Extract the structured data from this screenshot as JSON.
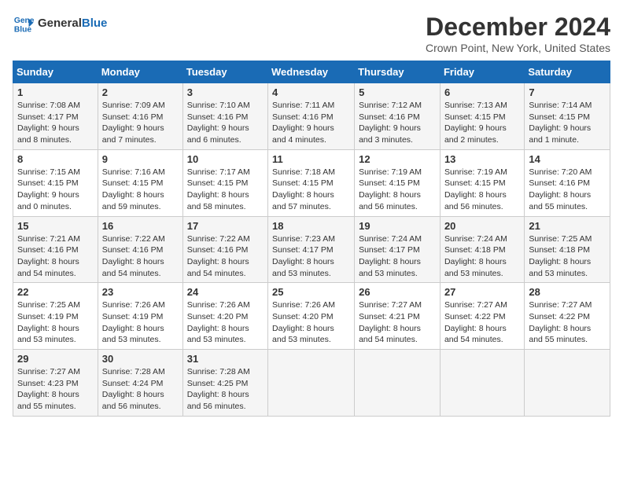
{
  "logo": {
    "text_general": "General",
    "text_blue": "Blue"
  },
  "title": "December 2024",
  "location": "Crown Point, New York, United States",
  "days_header": [
    "Sunday",
    "Monday",
    "Tuesday",
    "Wednesday",
    "Thursday",
    "Friday",
    "Saturday"
  ],
  "weeks": [
    [
      {
        "day": "1",
        "sunrise": "7:08 AM",
        "sunset": "4:17 PM",
        "daylight": "9 hours and 8 minutes."
      },
      {
        "day": "2",
        "sunrise": "7:09 AM",
        "sunset": "4:16 PM",
        "daylight": "9 hours and 7 minutes."
      },
      {
        "day": "3",
        "sunrise": "7:10 AM",
        "sunset": "4:16 PM",
        "daylight": "9 hours and 6 minutes."
      },
      {
        "day": "4",
        "sunrise": "7:11 AM",
        "sunset": "4:16 PM",
        "daylight": "9 hours and 4 minutes."
      },
      {
        "day": "5",
        "sunrise": "7:12 AM",
        "sunset": "4:16 PM",
        "daylight": "9 hours and 3 minutes."
      },
      {
        "day": "6",
        "sunrise": "7:13 AM",
        "sunset": "4:15 PM",
        "daylight": "9 hours and 2 minutes."
      },
      {
        "day": "7",
        "sunrise": "7:14 AM",
        "sunset": "4:15 PM",
        "daylight": "9 hours and 1 minute."
      }
    ],
    [
      {
        "day": "8",
        "sunrise": "7:15 AM",
        "sunset": "4:15 PM",
        "daylight": "9 hours and 0 minutes."
      },
      {
        "day": "9",
        "sunrise": "7:16 AM",
        "sunset": "4:15 PM",
        "daylight": "8 hours and 59 minutes."
      },
      {
        "day": "10",
        "sunrise": "7:17 AM",
        "sunset": "4:15 PM",
        "daylight": "8 hours and 58 minutes."
      },
      {
        "day": "11",
        "sunrise": "7:18 AM",
        "sunset": "4:15 PM",
        "daylight": "8 hours and 57 minutes."
      },
      {
        "day": "12",
        "sunrise": "7:19 AM",
        "sunset": "4:15 PM",
        "daylight": "8 hours and 56 minutes."
      },
      {
        "day": "13",
        "sunrise": "7:19 AM",
        "sunset": "4:15 PM",
        "daylight": "8 hours and 56 minutes."
      },
      {
        "day": "14",
        "sunrise": "7:20 AM",
        "sunset": "4:16 PM",
        "daylight": "8 hours and 55 minutes."
      }
    ],
    [
      {
        "day": "15",
        "sunrise": "7:21 AM",
        "sunset": "4:16 PM",
        "daylight": "8 hours and 54 minutes."
      },
      {
        "day": "16",
        "sunrise": "7:22 AM",
        "sunset": "4:16 PM",
        "daylight": "8 hours and 54 minutes."
      },
      {
        "day": "17",
        "sunrise": "7:22 AM",
        "sunset": "4:16 PM",
        "daylight": "8 hours and 54 minutes."
      },
      {
        "day": "18",
        "sunrise": "7:23 AM",
        "sunset": "4:17 PM",
        "daylight": "8 hours and 53 minutes."
      },
      {
        "day": "19",
        "sunrise": "7:24 AM",
        "sunset": "4:17 PM",
        "daylight": "8 hours and 53 minutes."
      },
      {
        "day": "20",
        "sunrise": "7:24 AM",
        "sunset": "4:18 PM",
        "daylight": "8 hours and 53 minutes."
      },
      {
        "day": "21",
        "sunrise": "7:25 AM",
        "sunset": "4:18 PM",
        "daylight": "8 hours and 53 minutes."
      }
    ],
    [
      {
        "day": "22",
        "sunrise": "7:25 AM",
        "sunset": "4:19 PM",
        "daylight": "8 hours and 53 minutes."
      },
      {
        "day": "23",
        "sunrise": "7:26 AM",
        "sunset": "4:19 PM",
        "daylight": "8 hours and 53 minutes."
      },
      {
        "day": "24",
        "sunrise": "7:26 AM",
        "sunset": "4:20 PM",
        "daylight": "8 hours and 53 minutes."
      },
      {
        "day": "25",
        "sunrise": "7:26 AM",
        "sunset": "4:20 PM",
        "daylight": "8 hours and 53 minutes."
      },
      {
        "day": "26",
        "sunrise": "7:27 AM",
        "sunset": "4:21 PM",
        "daylight": "8 hours and 54 minutes."
      },
      {
        "day": "27",
        "sunrise": "7:27 AM",
        "sunset": "4:22 PM",
        "daylight": "8 hours and 54 minutes."
      },
      {
        "day": "28",
        "sunrise": "7:27 AM",
        "sunset": "4:22 PM",
        "daylight": "8 hours and 55 minutes."
      }
    ],
    [
      {
        "day": "29",
        "sunrise": "7:27 AM",
        "sunset": "4:23 PM",
        "daylight": "8 hours and 55 minutes."
      },
      {
        "day": "30",
        "sunrise": "7:28 AM",
        "sunset": "4:24 PM",
        "daylight": "8 hours and 56 minutes."
      },
      {
        "day": "31",
        "sunrise": "7:28 AM",
        "sunset": "4:25 PM",
        "daylight": "8 hours and 56 minutes."
      },
      null,
      null,
      null,
      null
    ]
  ]
}
